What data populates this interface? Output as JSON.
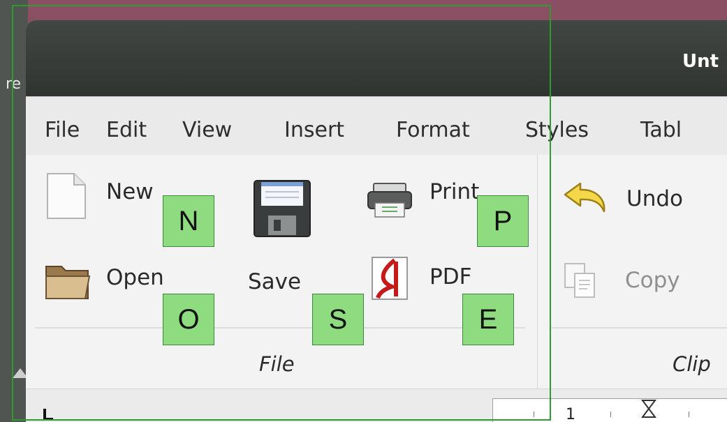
{
  "background_window": {
    "cut_text": "re"
  },
  "window": {
    "title": "Unt"
  },
  "menubar": {
    "items": [
      {
        "label": "File"
      },
      {
        "label": "Edit"
      },
      {
        "label": "View"
      },
      {
        "label": "Insert"
      },
      {
        "label": "Format"
      },
      {
        "label": "Styles"
      },
      {
        "label": "Tabl"
      }
    ]
  },
  "ribbon": {
    "file_group": {
      "label": "File",
      "new_label": "New",
      "save_label": "Save",
      "print_label": "Print",
      "open_label": "Open",
      "pdf_label": "PDF"
    },
    "clipboard_group": {
      "label": "Clip",
      "undo_label": "Undo",
      "copy_label": "Copy"
    },
    "icons": {
      "new": "new-document-icon",
      "save": "floppy-disk-icon",
      "print": "printer-icon",
      "open": "folder-icon",
      "pdf": "pdf-icon",
      "undo": "undo-arrow-icon",
      "copy": "copy-icon"
    }
  },
  "ruler": {
    "numbers": [
      "1"
    ]
  },
  "hints": {
    "new": "N",
    "print": "P",
    "open": "O",
    "save": "S",
    "pdf": "E"
  },
  "colors": {
    "desktop": "#8a4f62",
    "titlebar": "#2f3431",
    "hint_fill": "#8fdc80",
    "frame": "#2e9b2e"
  }
}
